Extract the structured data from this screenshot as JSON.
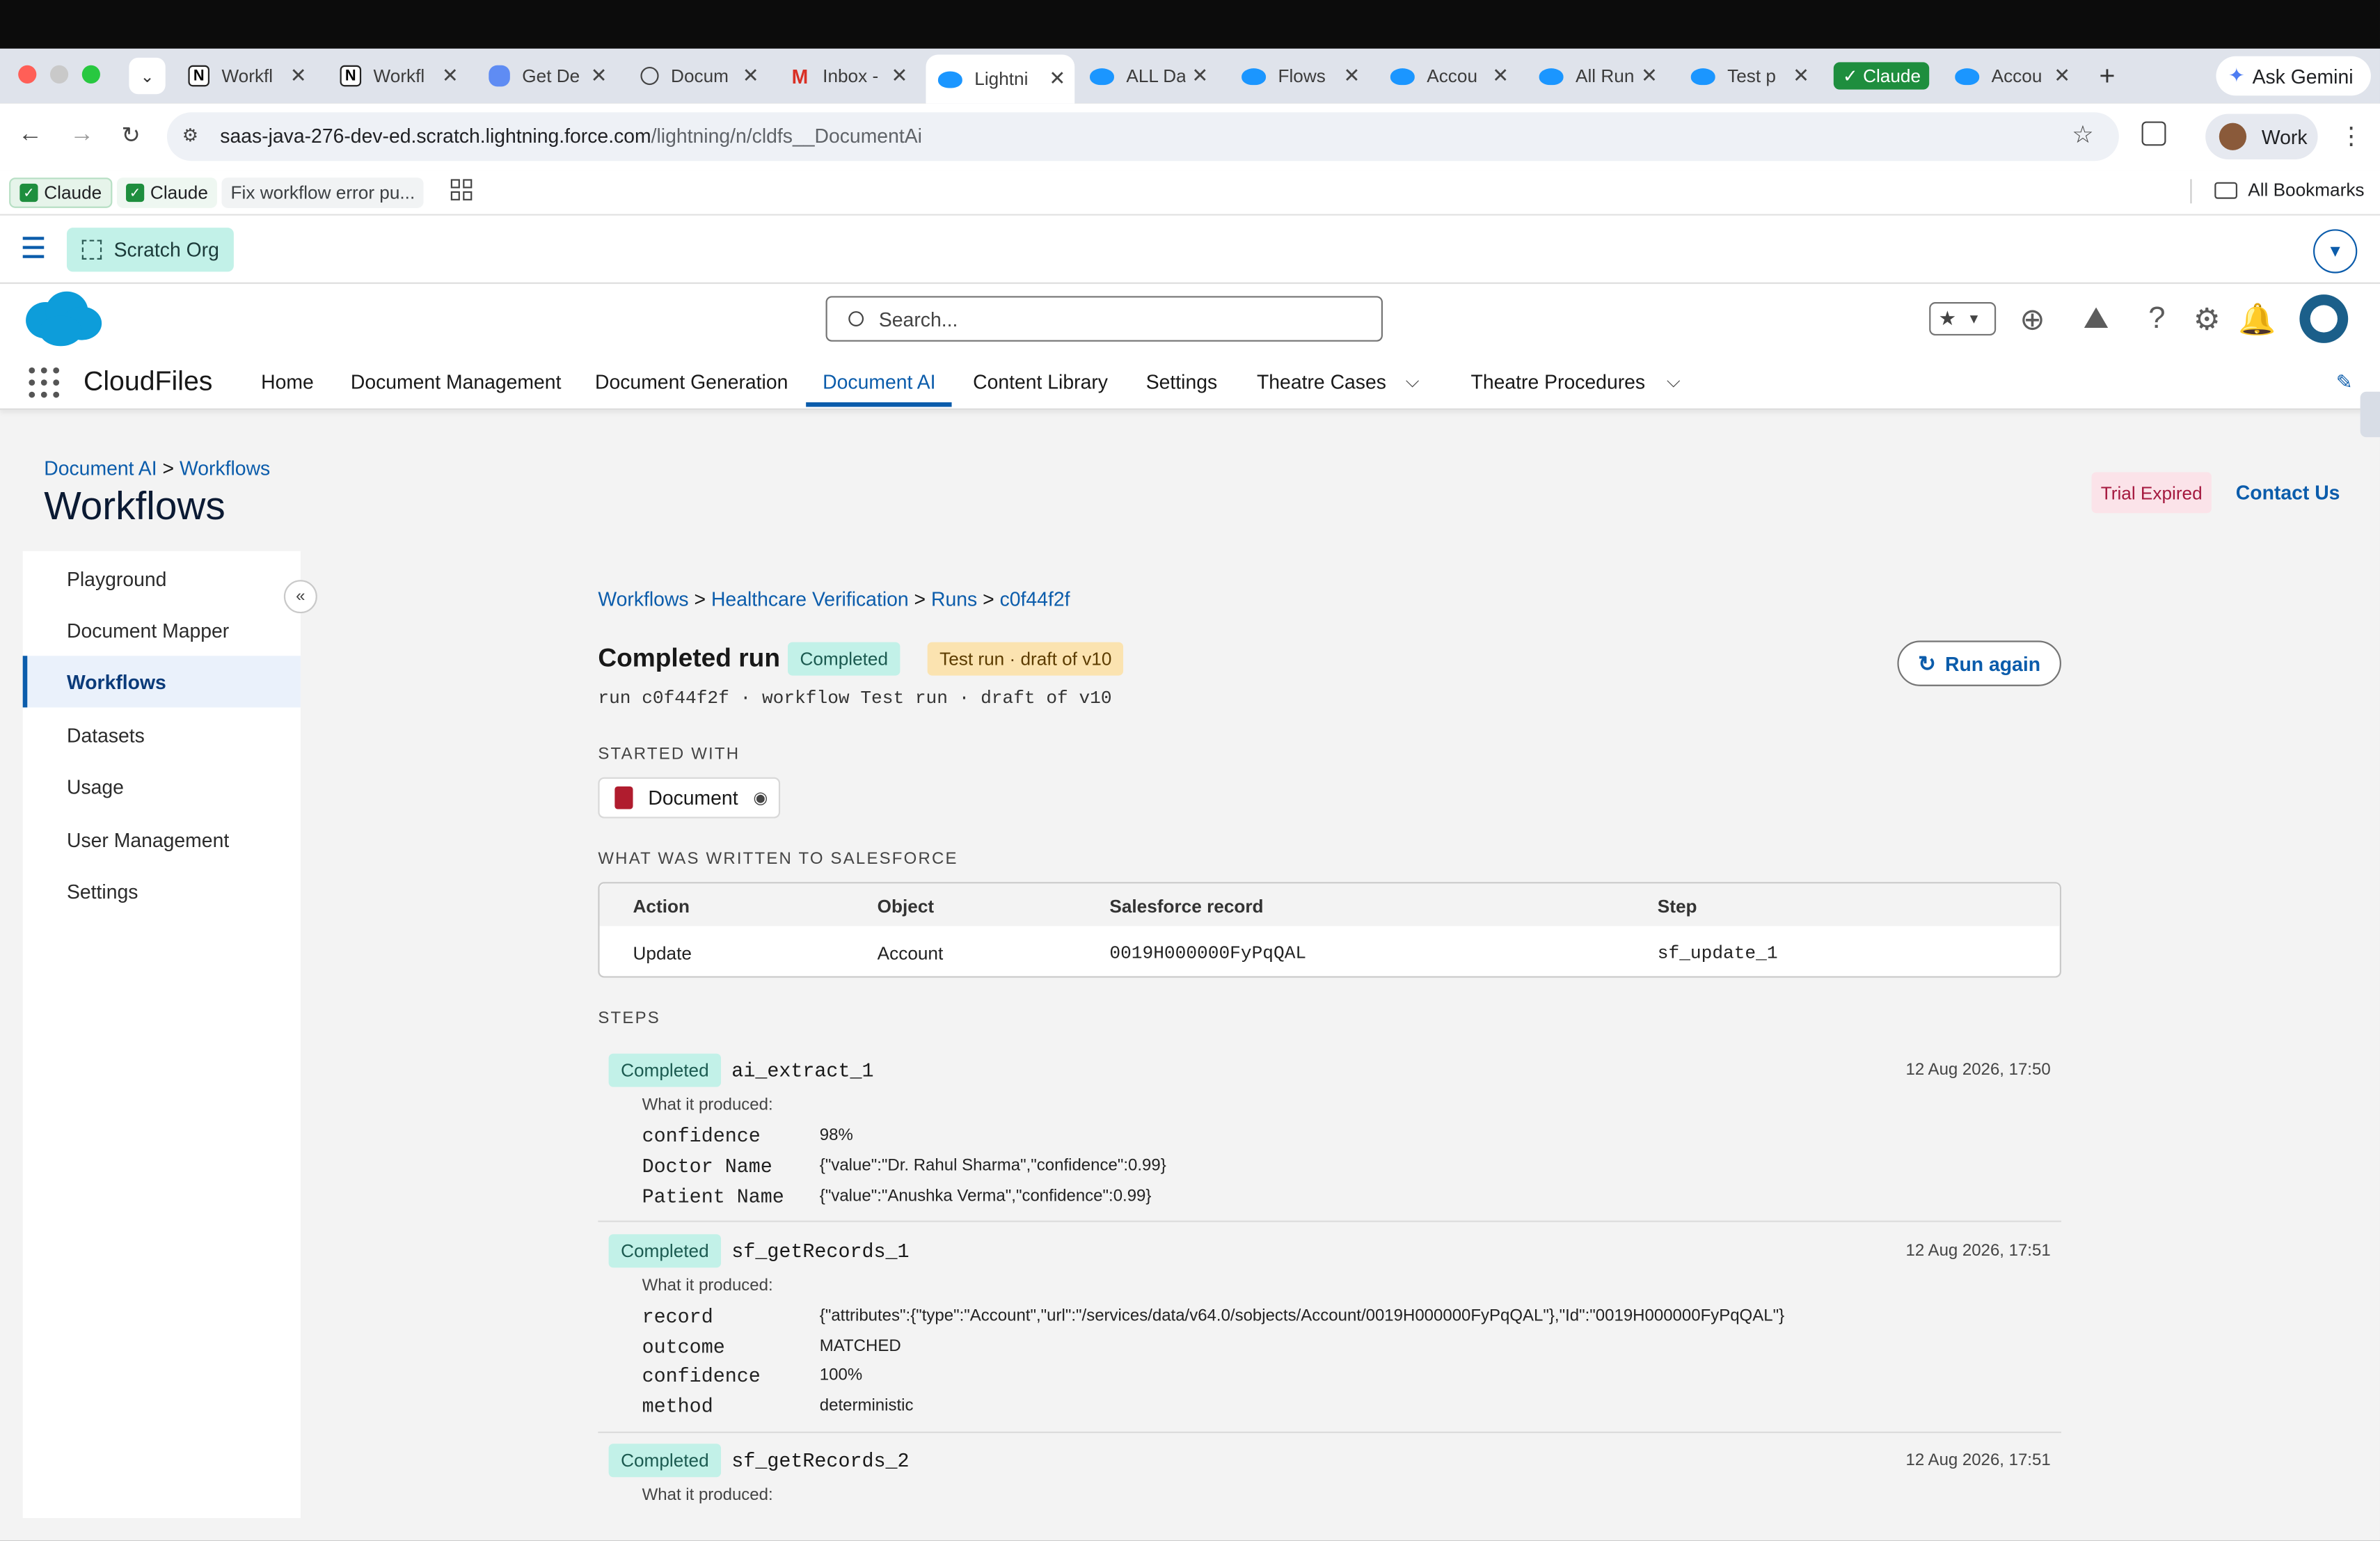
{
  "browser": {
    "tabs": [
      {
        "label": "Workfl",
        "icon": "notion-icon"
      },
      {
        "label": "Workfl",
        "icon": "notion-icon"
      },
      {
        "label": "Get De",
        "icon": "google-drive-icon"
      },
      {
        "label": "Docum",
        "icon": "openai-icon"
      },
      {
        "label": "Inbox -",
        "icon": "gmail-icon"
      },
      {
        "label": "Lightni",
        "icon": "salesforce-icon",
        "active": true
      },
      {
        "label": "ALL Da",
        "icon": "salesforce-icon"
      },
      {
        "label": "Flows",
        "icon": "salesforce-icon"
      },
      {
        "label": "Accou",
        "icon": "salesforce-icon"
      },
      {
        "label": "All Run",
        "icon": "salesforce-icon"
      },
      {
        "label": "Test p",
        "icon": "salesforce-icon"
      },
      {
        "label": "Claude",
        "icon": "claude-icon",
        "group": true
      },
      {
        "label": "Accou",
        "icon": "salesforce-icon"
      }
    ],
    "ask_gemini": "Ask Gemini",
    "url_host": "saas-java-276-dev-ed.scratch.lightning.force.com",
    "url_path": "/lightning/n/cldfs__DocumentAi",
    "profile": "Work",
    "bookmarks": [
      "Claude",
      "Claude",
      "Fix workflow error pu..."
    ],
    "all_bookmarks": "All Bookmarks"
  },
  "org": {
    "label": "Scratch Org"
  },
  "sf": {
    "search_placeholder": "Search...",
    "app_name": "CloudFiles",
    "nav": [
      "Home",
      "Document Management",
      "Document Generation",
      "Document AI",
      "Content Library",
      "Settings",
      "Theatre Cases",
      "Theatre Procedures"
    ],
    "active_nav": "Document AI"
  },
  "page": {
    "breadcrumb_parent": "Document AI",
    "breadcrumb_sep": ">",
    "breadcrumb_current": "Workflows",
    "title": "Workflows",
    "trial": "Trial Expired",
    "contact": "Contact Us"
  },
  "sidebar": {
    "items": [
      "Playground",
      "Document Mapper",
      "Workflows",
      "Datasets",
      "Usage",
      "User Management",
      "Settings"
    ],
    "active": "Workflows"
  },
  "run": {
    "crumbs": [
      "Workflows",
      "Healthcare Verification",
      "Runs",
      "c0f44f2f"
    ],
    "heading": "Completed run",
    "status": "Completed",
    "test_badge": "Test run · draft of v10",
    "subtitle": "run c0f44f2f · workflow Test run · draft of v10",
    "run_again": "Run again",
    "started_with_label": "STARTED WITH",
    "document_chip": "Document",
    "written_label": "WHAT WAS WRITTEN TO SALESFORCE",
    "table": {
      "headers": [
        "Action",
        "Object",
        "Salesforce record",
        "Step"
      ],
      "rows": [
        [
          "Update",
          "Account",
          "0019H000000FyPqQAL",
          "sf_update_1"
        ]
      ]
    },
    "steps_label": "STEPS",
    "produced_label": "What it produced:",
    "steps": [
      {
        "status": "Completed",
        "name": "ai_extract_1",
        "time": "12 Aug 2026, 17:50",
        "outputs": [
          {
            "key": "confidence",
            "value": "98%"
          },
          {
            "key": "Doctor Name",
            "value": "{\"value\":\"Dr. Rahul Sharma\",\"confidence\":0.99}"
          },
          {
            "key": "Patient Name",
            "value": "{\"value\":\"Anushka Verma\",\"confidence\":0.99}"
          }
        ]
      },
      {
        "status": "Completed",
        "name": "sf_getRecords_1",
        "time": "12 Aug 2026, 17:51",
        "outputs": [
          {
            "key": "record",
            "value": "{\"attributes\":{\"type\":\"Account\",\"url\":\"/services/data/v64.0/sobjects/Account/0019H000000FyPqQAL\"},\"Id\":\"0019H000000FyPqQAL\"}"
          },
          {
            "key": "outcome",
            "value": "MATCHED"
          },
          {
            "key": "confidence",
            "value": "100%"
          },
          {
            "key": "method",
            "value": "deterministic"
          }
        ]
      },
      {
        "status": "Completed",
        "name": "sf_getRecords_2",
        "time": "12 Aug 2026, 17:51",
        "outputs": []
      }
    ]
  }
}
